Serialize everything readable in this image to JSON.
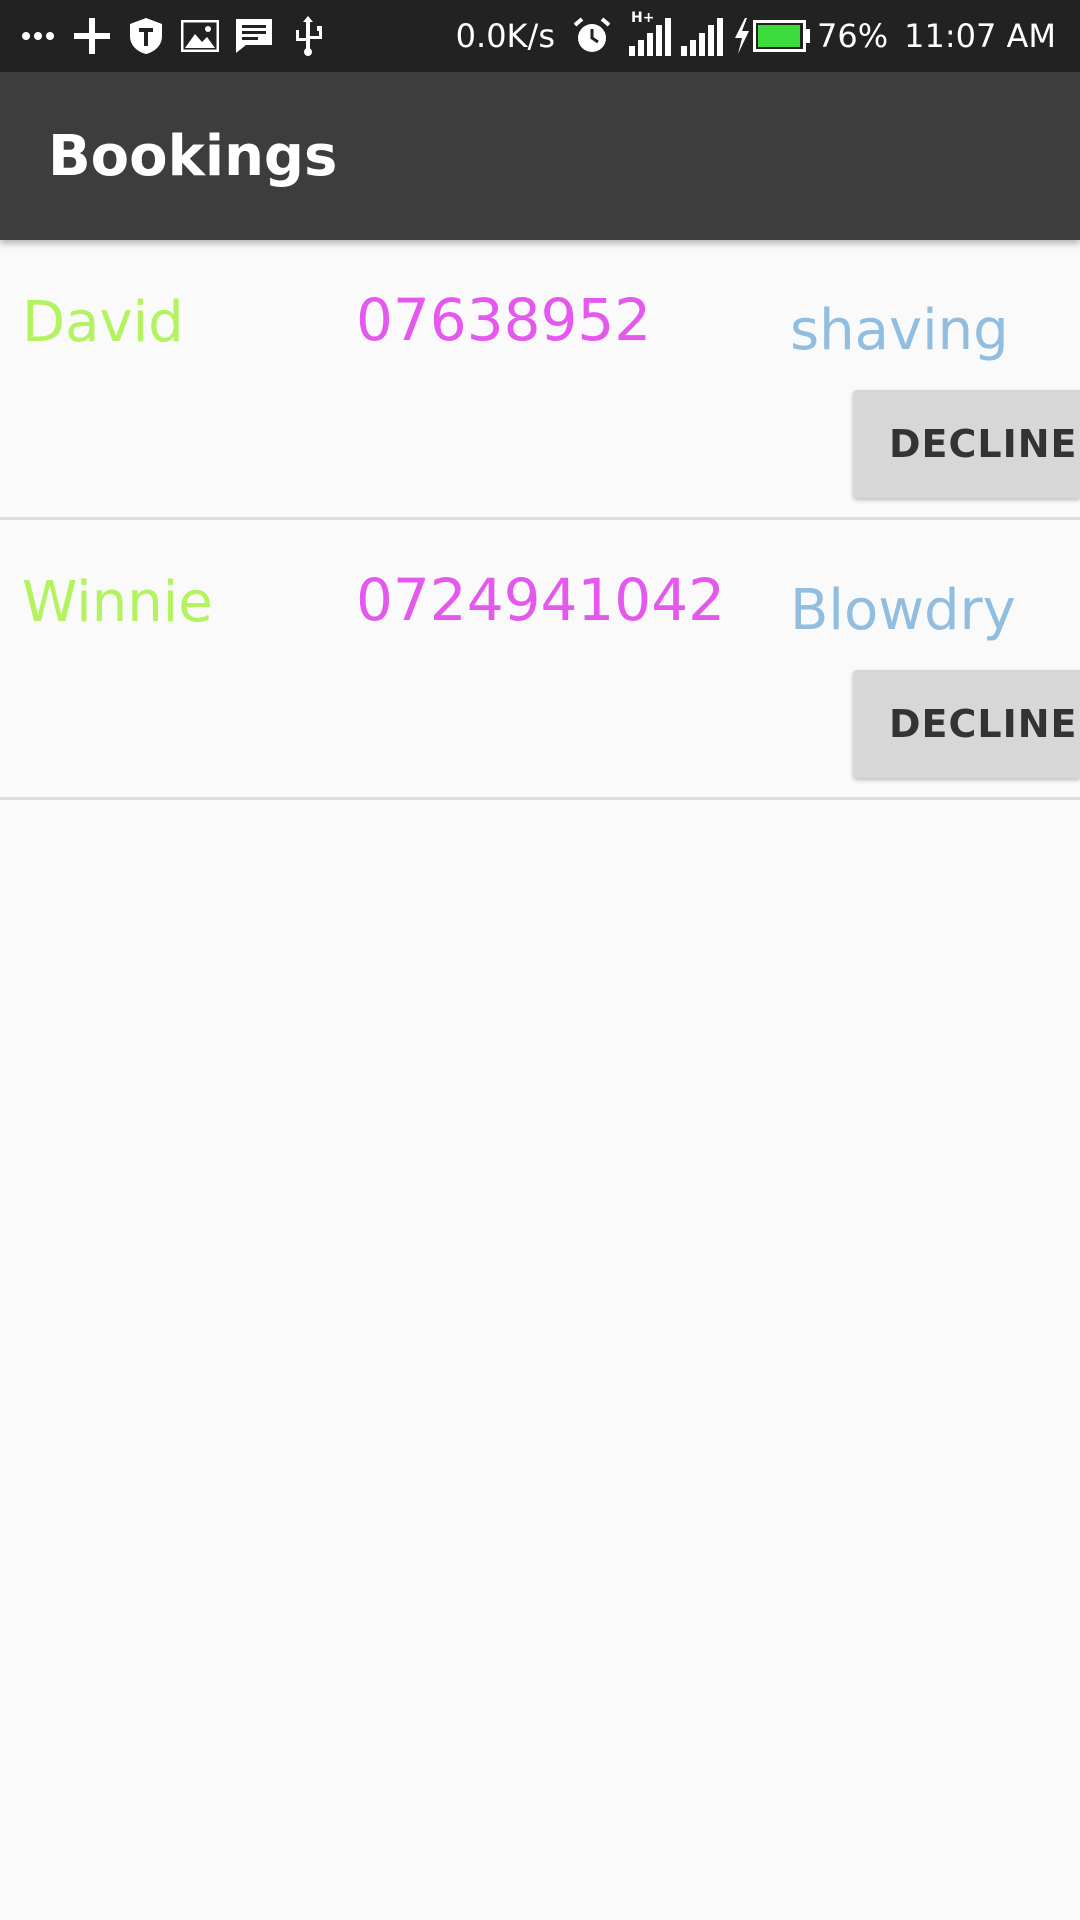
{
  "status_bar": {
    "net_speed": "0.0K/s",
    "battery": "76%",
    "time": "11:07 AM",
    "icons_left": [
      "more-icon",
      "plus-icon",
      "shield-icon",
      "image-icon",
      "message-icon",
      "usb-icon"
    ],
    "icons_right": [
      "alarm-icon",
      "signal-icon",
      "signal-icon",
      "charging-icon",
      "battery-icon"
    ],
    "network_type": "H+"
  },
  "app_bar": {
    "title": "Bookings",
    "background": "#3d3d3d"
  },
  "bookings": [
    {
      "name": "David",
      "phone": "07638952",
      "service": "shaving",
      "action": "DECLINE"
    },
    {
      "name": "Winnie",
      "phone": "0724941042",
      "service": "Blowdry",
      "action": "DECLINE"
    }
  ],
  "colors": {
    "name": "#b2f35f",
    "phone": "#e458ed",
    "service": "#90bde0",
    "button_bg": "#d7d7d7"
  }
}
